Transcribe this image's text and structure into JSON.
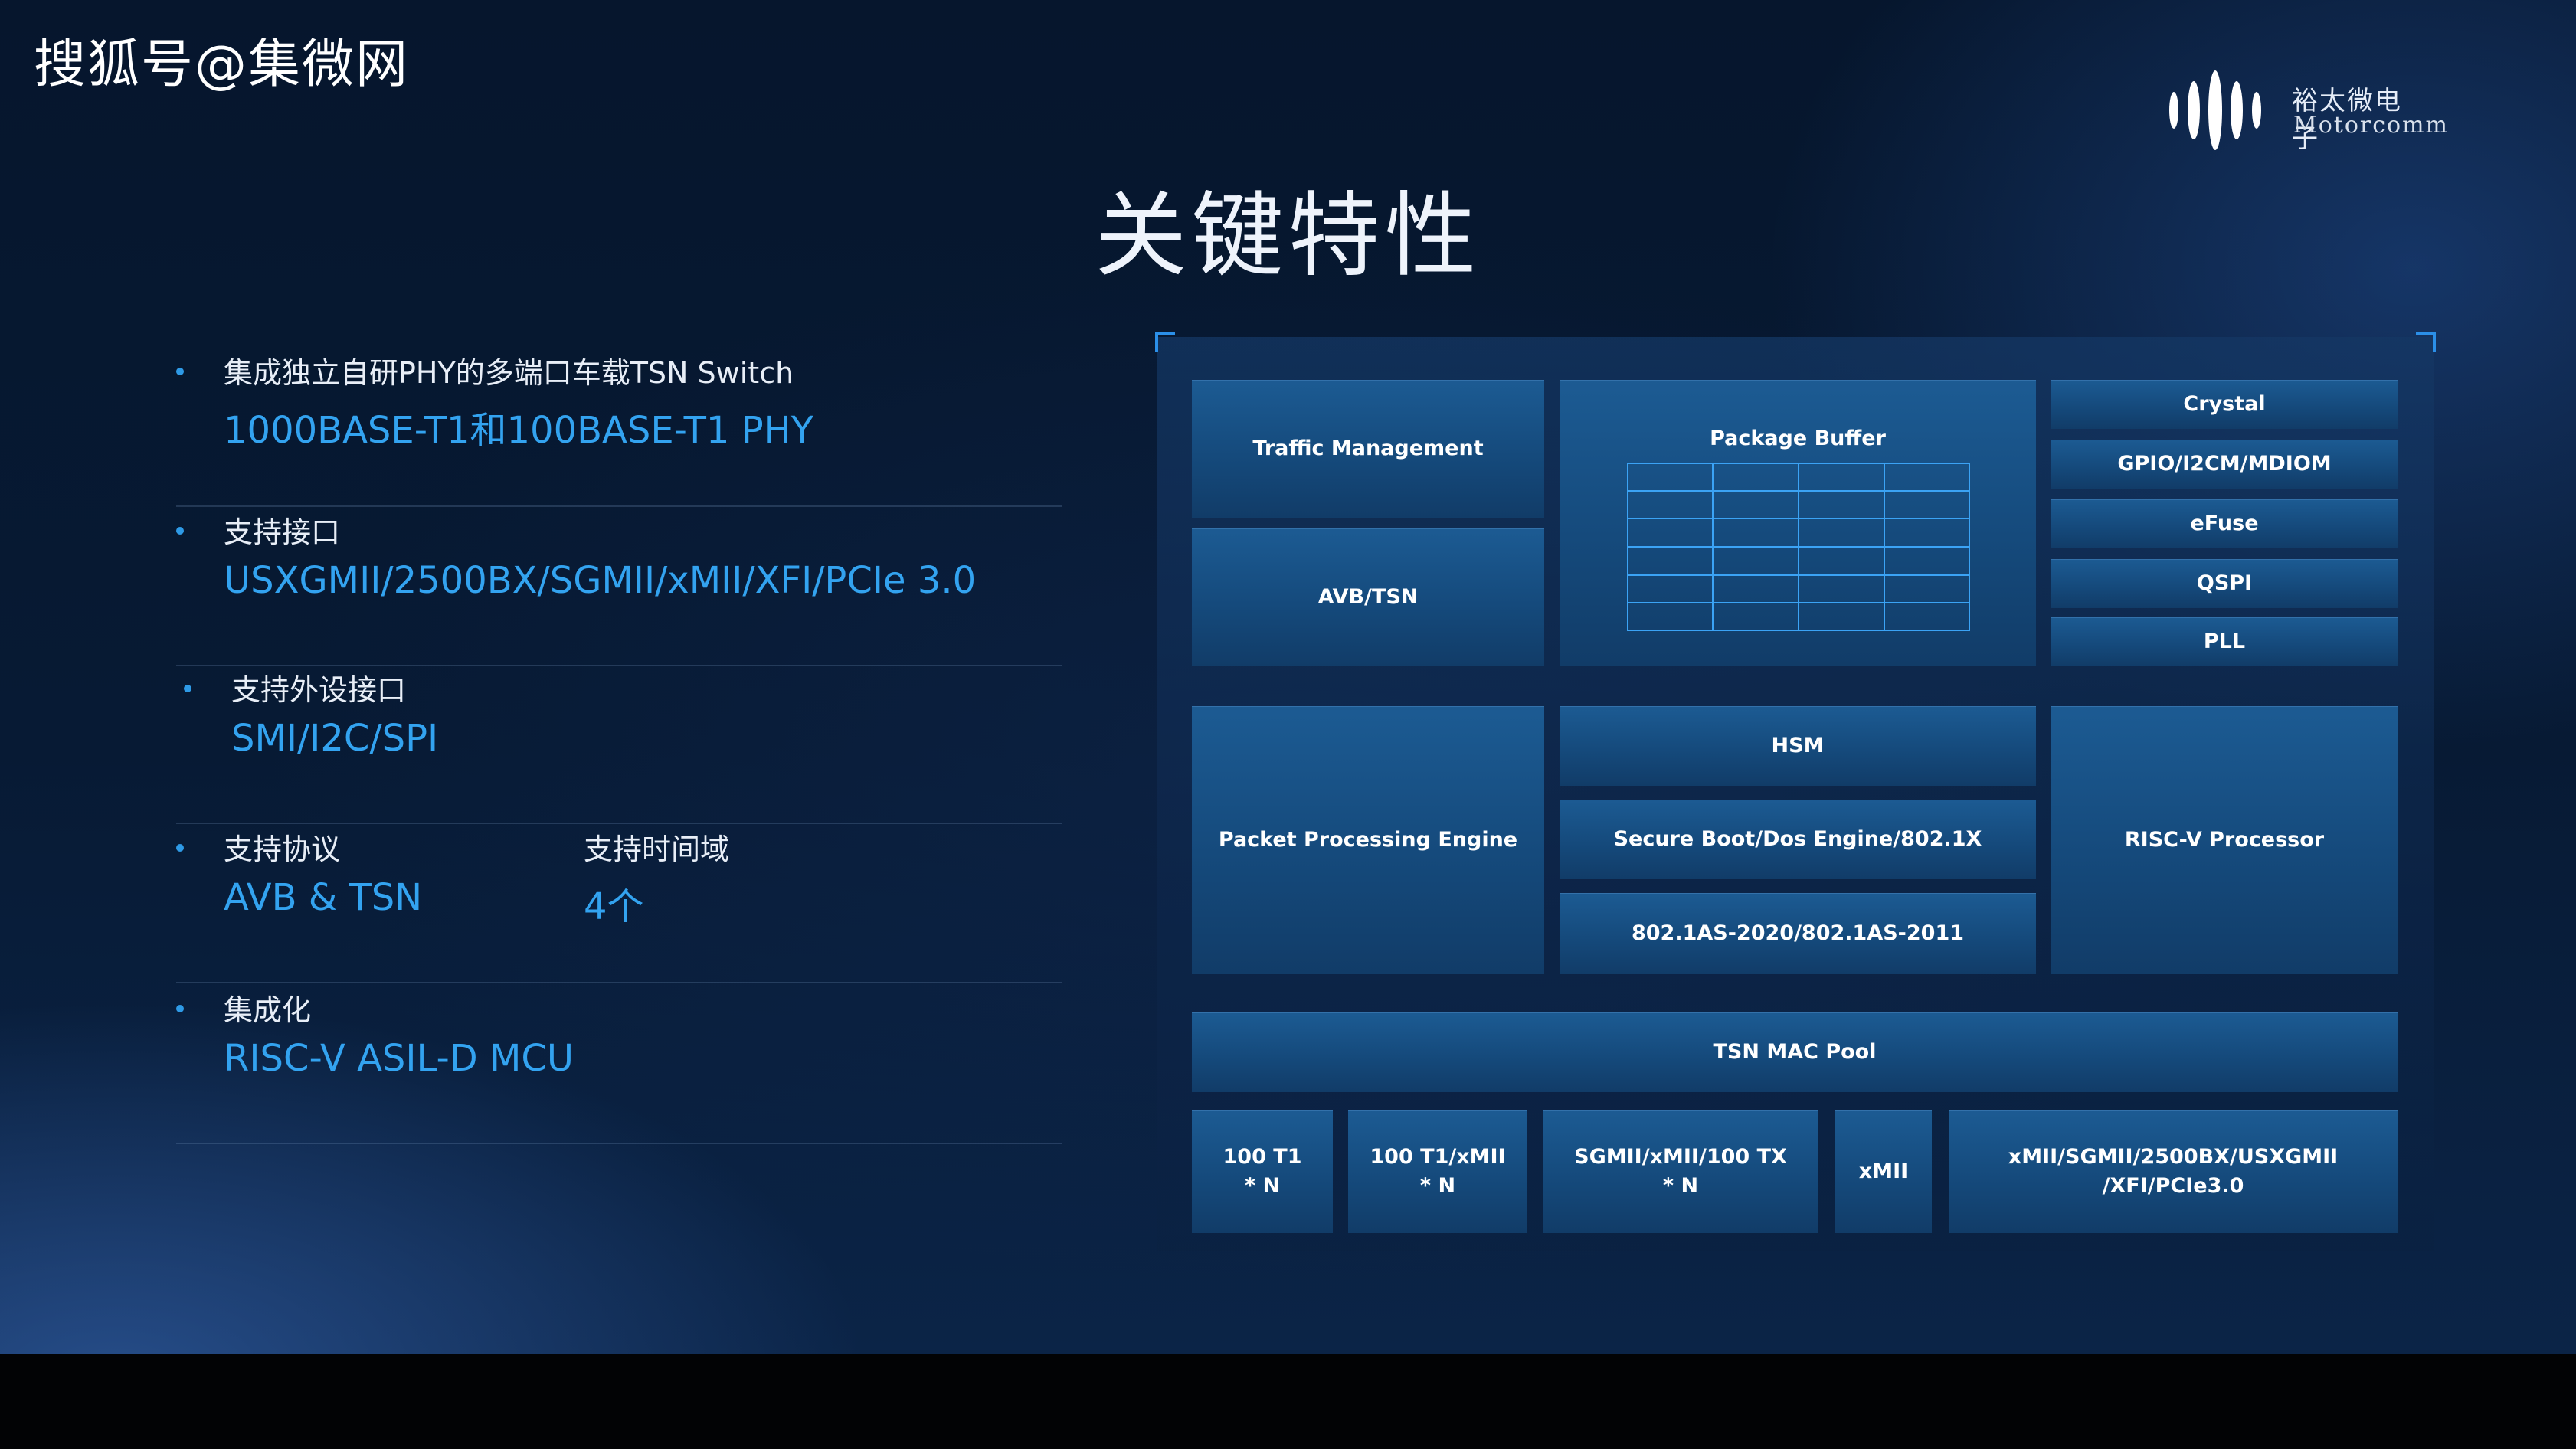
{
  "watermark": "搜狐号@集微网",
  "logo": {
    "name_cn": "裕太微电子",
    "name_en": "Motorcomm"
  },
  "title": "关键特性",
  "features": [
    {
      "label": "集成独立自研PHY的多端口车载TSN  Switch",
      "value": "1000BASE-T1和100BASE-T1 PHY"
    },
    {
      "label": "支持接口",
      "value": "USXGMII/2500BX/SGMII/xMII/XFI/PCIe 3.0"
    },
    {
      "label": "支持外设接口",
      "value": "SMI/I2C/SPI"
    },
    {
      "label": "支持协议",
      "value": "AVB & TSN",
      "label2": "支持时间域",
      "value2": "4个"
    },
    {
      "label": "集成化",
      "value": "RISC-V ASIL-D  MCU"
    }
  ],
  "diagram": {
    "traffic_management": "Traffic Management",
    "avb_tsn": "AVB/TSN",
    "package_buffer": "Package Buffer",
    "crystal": "Crystal",
    "gpio": "GPIO/I2CM/MDIOM",
    "efuse": "eFuse",
    "qspi": "QSPI",
    "pll": "PLL",
    "packet_engine": "Packet Processing Engine",
    "hsm": "HSM",
    "secure_boot": "Secure Boot/Dos Engine/802.1X",
    "as2020": "802.1AS-2020/802.1AS-2011",
    "riscv": "RISC-V Processor",
    "mac_pool": "TSN MAC Pool",
    "port_100t1": "100 T1\n* N",
    "port_100t1_xmii": "100 T1/xMII\n* N",
    "port_sgmii": "SGMII/xMII/100 TX\n* N",
    "port_xmii": "xMII",
    "port_usxgmii": "xMII/SGMII/2500BX/USXGMII\n/XFI/PCIe3.0"
  },
  "colors": {
    "accent": "#33a3f0",
    "block": "#1a5488",
    "background": "#071a34"
  }
}
